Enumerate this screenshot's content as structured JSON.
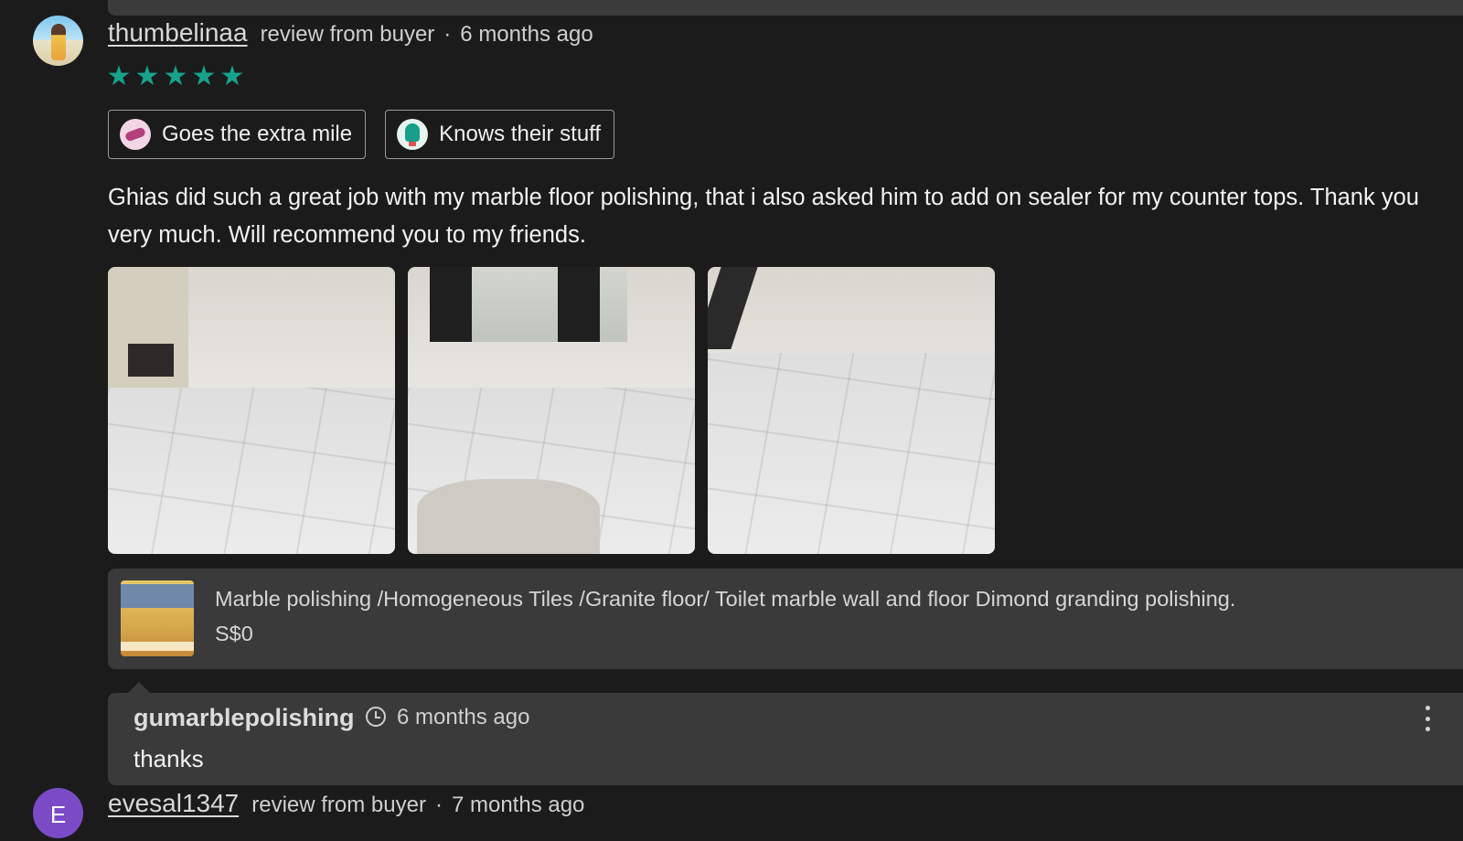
{
  "review1": {
    "username": "thumbelinaa",
    "role": "review from buyer",
    "separator": "·",
    "time": "6 months ago",
    "rating": 5,
    "star_color": "#15a38c",
    "badges": [
      {
        "label": "Goes the extra mile",
        "icon": "extra-mile-icon"
      },
      {
        "label": "Knows their stuff",
        "icon": "lightbulb-icon"
      }
    ],
    "text": "Ghias did such a great job with my marble floor polishing, that i also asked him to add on sealer for my counter tops. Thank you very much. Will recommend you to my friends.",
    "photos": 3
  },
  "gig": {
    "title": "Marble polishing /Homogeneous Tiles /Granite floor/ Toilet marble wall and floor Dimond granding polishing.",
    "price": "S$0"
  },
  "reply": {
    "seller": "gumarblepolishing",
    "time": "6 months ago",
    "text": "thanks"
  },
  "review2": {
    "avatar_letter": "E",
    "avatar_color": "#7b4bc7",
    "username": "evesal1347",
    "role": "review from buyer",
    "separator": "·",
    "time": "7 months ago"
  }
}
